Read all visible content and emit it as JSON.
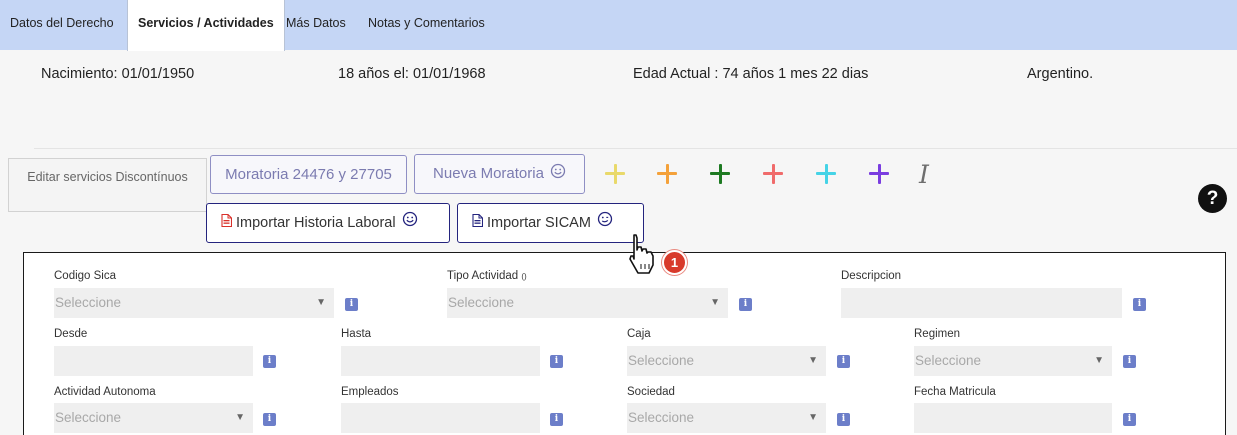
{
  "tabs": [
    {
      "label": "Datos del Derecho"
    },
    {
      "label": "Servicios / Actividades",
      "active": true
    },
    {
      "label": "Más Datos"
    },
    {
      "label": "Notas y Comentarios"
    }
  ],
  "info": {
    "birth": "Nacimiento: 01/01/1950",
    "age18": "18 años el: 01/01/1968",
    "current_age": "Edad Actual : 74 años 1 mes 22 dias",
    "nationality": "Argentino."
  },
  "buttons": {
    "edit_services": "Editar servicios Discontínuos",
    "moratoria": "Moratoria 24476 y 27705",
    "nueva_moratoria": "Nueva Moratoria",
    "import_historia": "Importar Historia Laboral",
    "import_sicam": "Importar SICAM",
    "italic_label": "I",
    "help": "?"
  },
  "plus_buttons": [
    {
      "name": "plus-yellow",
      "color": "#e9d96a"
    },
    {
      "name": "plus-orange",
      "color": "#f4a13a"
    },
    {
      "name": "plus-green",
      "color": "#1e7a22"
    },
    {
      "name": "plus-red",
      "color": "#f06b6b"
    },
    {
      "name": "plus-cyan",
      "color": "#45d3e6"
    },
    {
      "name": "plus-purple",
      "color": "#7a3de0"
    }
  ],
  "form": {
    "codigo_sica": {
      "label": "Codigo Sica",
      "value": "Seleccione"
    },
    "tipo_actividad": {
      "label": "Tipo Actividad",
      "label_suffix": "()",
      "value": "Seleccione"
    },
    "descripcion": {
      "label": "Descripcion",
      "value": ""
    },
    "desde": {
      "label": "Desde",
      "value": ""
    },
    "hasta": {
      "label": "Hasta",
      "value": ""
    },
    "caja": {
      "label": "Caja",
      "value": "Seleccione"
    },
    "regimen": {
      "label": "Regimen",
      "value": "Seleccione"
    },
    "actividad_autonoma": {
      "label": "Actividad Autonoma",
      "value": "Seleccione"
    },
    "empleados": {
      "label": "Empleados",
      "value": ""
    },
    "sociedad": {
      "label": "Sociedad",
      "value": "Seleccione"
    },
    "fecha_matricula": {
      "label": "Fecha Matricula",
      "value": ""
    }
  },
  "info_icon_label": "i",
  "step_badge": "1",
  "colors": {
    "tab_bar": "#c5d6f5",
    "import_border": "#24247e",
    "outline_button": "#8f8fc4",
    "info_icon": "#6c7ec9",
    "badge": "#d83a2b"
  }
}
